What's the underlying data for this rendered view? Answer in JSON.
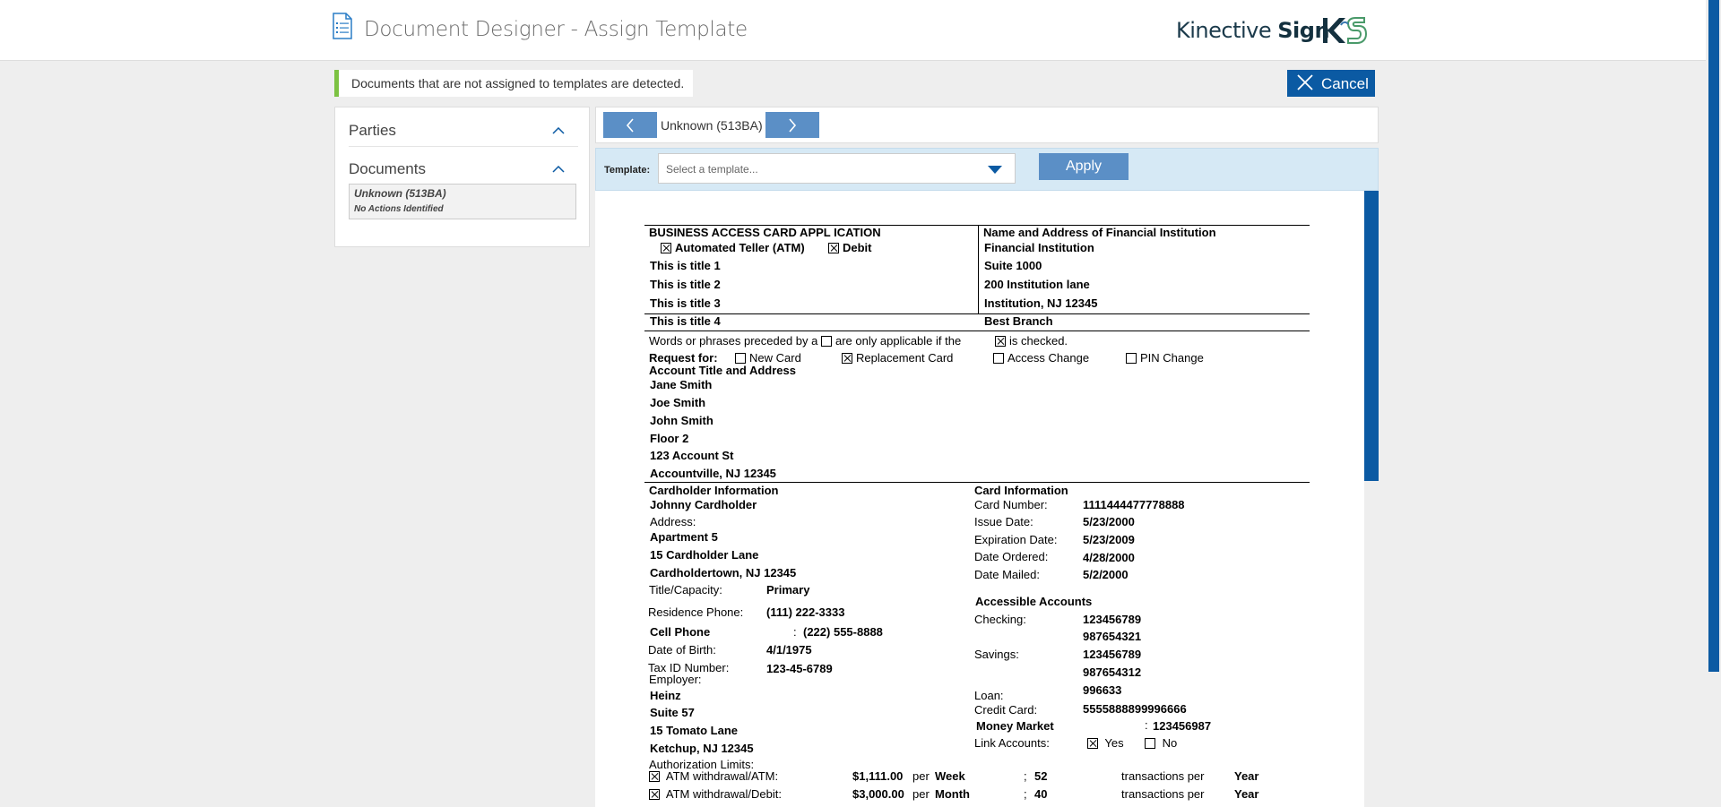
{
  "header": {
    "title": "Document Designer - Assign Template",
    "brand_light": "Kinective ",
    "brand_bold": "Sign"
  },
  "alert": {
    "text": "Documents that are not assigned to templates are detected."
  },
  "cancel_label": "Cancel",
  "sidebar": {
    "parties_label": "Parties",
    "documents_label": "Documents",
    "doc_name": "Unknown (513BA)",
    "doc_status": "No Actions Identified"
  },
  "nav": {
    "current": "Unknown (513BA)"
  },
  "template": {
    "label": "Template:",
    "placeholder": "Select a template...",
    "apply_label": "Apply"
  },
  "doc": {
    "app_title": "BUSINESS ACCESS CARD APPL ICATION",
    "atm_label": "Automated Teller (ATM)",
    "debit_label": "Debit",
    "titles": [
      "This is title 1",
      "This is title 2",
      "This is title 3",
      "This is title 4"
    ],
    "fi_header": "Name and Address of Financial Institution",
    "fi_lines": [
      "Financial Institution",
      "Suite 1000",
      "200 Institution lane",
      "Institution, NJ 12345",
      "Best Branch"
    ],
    "words_pre": "Words or phrases preceded by a",
    "words_mid": "are only applicable if the",
    "words_post": "is checked.",
    "request_for": "Request for:",
    "req_new": "New Card",
    "req_replace": "Replacement Card",
    "req_access": "Access Change",
    "req_pin": "PIN Change",
    "acct_title_header": "Account Title and Address",
    "acct_lines": [
      "Jane Smith",
      "Joe Smith",
      "John Smith",
      "Floor 2",
      "123 Account St",
      "Accountville, NJ 12345"
    ],
    "ch_header": "Cardholder Information",
    "ch_name": "Johnny Cardholder",
    "address_label": "Address:",
    "addr_lines": [
      "Apartment 5",
      "15 Cardholder Lane",
      "Cardholdertown, NJ 12345"
    ],
    "title_cap_label": "Title/Capacity:",
    "title_cap_value": "Primary",
    "res_phone_label": "Residence Phone:",
    "res_phone_value": "(111) 222-3333",
    "cell_label": "Cell Phone",
    "cell_sep": ":",
    "cell_value": "(222) 555-8888",
    "dob_label": "Date of Birth:",
    "dob_value": "4/1/1975",
    "taxid_label": "Tax ID Number:",
    "taxid_value": "123-45-6789",
    "employer_label": "Employer:",
    "employer_lines": [
      "Heinz",
      "Suite 57",
      "15 Tomato Lane",
      "Ketchup, NJ 12345"
    ],
    "auth_label": "Authorization Limits:",
    "limits": [
      {
        "label": "ATM withdrawal/ATM:",
        "amount": "$1,111.00",
        "per": "per",
        "period": "Week",
        "sep": ";",
        "count": "52",
        "tx": "transactions per",
        "tx_period": "Year"
      },
      {
        "label": "ATM withdrawal/Debit:",
        "amount": "$3,000.00",
        "per": "per",
        "period": "Month",
        "sep": ";",
        "count": "40",
        "tx": "transactions per",
        "tx_period": "Year"
      }
    ],
    "card_header": "Card Information",
    "card_rows": [
      {
        "label": "Card Number:",
        "value": "1111444477778888"
      },
      {
        "label": "Issue Date:",
        "value": "5/23/2000"
      },
      {
        "label": "Expiration Date:",
        "value": "5/23/2009"
      },
      {
        "label": "Date Ordered:",
        "value": "4/28/2000"
      },
      {
        "label": "Date Mailed:",
        "value": "5/2/2000"
      }
    ],
    "accessible_header": "Accessible Accounts",
    "checking_label": "Checking:",
    "checking_values": [
      "123456789",
      "987654321"
    ],
    "savings_label": "Savings:",
    "savings_values": [
      "123456789",
      "987654312"
    ],
    "loan_value": "996633",
    "loan_label": "Loan:",
    "credit_label": "Credit Card:",
    "credit_value": "5555888899996666",
    "mm_label": "Money Market",
    "mm_sep": ":",
    "mm_value": "123456987",
    "link_label": "Link Accounts:",
    "link_yes": "Yes",
    "link_no": "No"
  },
  "colors": {
    "brand_blue": "#0b5aa3",
    "button_blue": "#5b8fc6",
    "alert_green": "#7cc242",
    "template_bar": "#d6e9f5"
  }
}
